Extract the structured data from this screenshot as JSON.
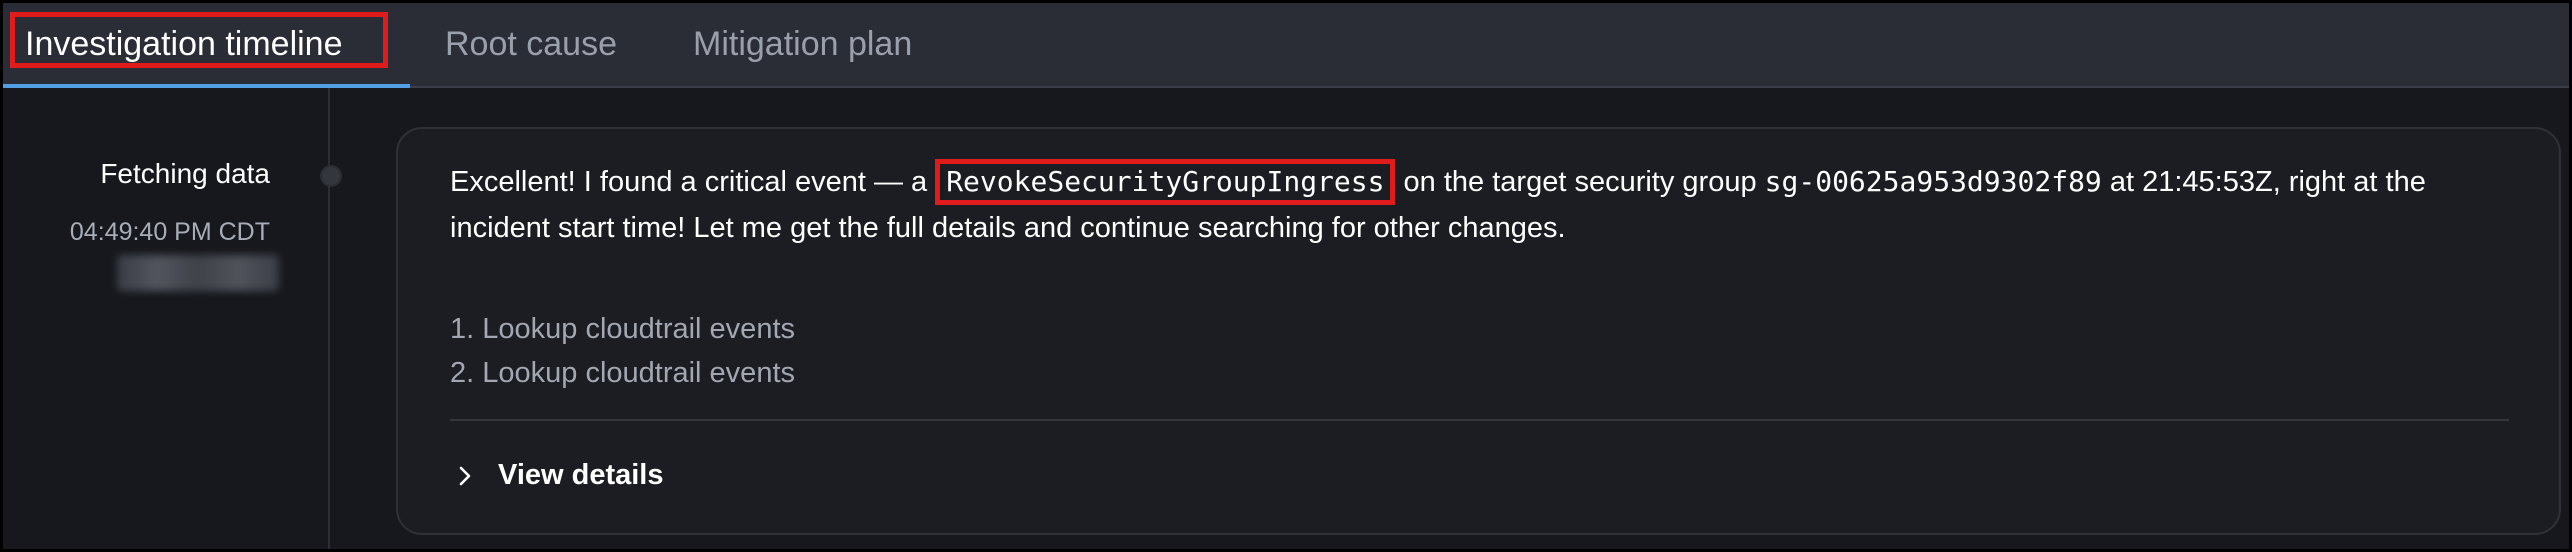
{
  "tabs": [
    {
      "label": "Investigation timeline",
      "active": true
    },
    {
      "label": "Root cause",
      "active": false
    },
    {
      "label": "Mitigation plan",
      "active": false
    }
  ],
  "timeline": {
    "entry_title": "Fetching data",
    "entry_time": "04:49:40 PM CDT"
  },
  "message": {
    "part1": "Excellent! I found a critical event — a ",
    "event_name": "RevokeSecurityGroupIngress",
    "part2": " on the target security group ",
    "security_group": "sg-00625a953d9302f89",
    "part3": " at 21:45:53Z, right at the incident start time! Let me get the full details and continue searching for other changes."
  },
  "steps": [
    "1. Lookup cloudtrail events",
    "2. Lookup cloudtrail events"
  ],
  "details_label": "View details",
  "colors": {
    "accent": "#539fe5",
    "highlight": "#e01b1b",
    "background": "#16181d",
    "card": "#1c1d22"
  }
}
